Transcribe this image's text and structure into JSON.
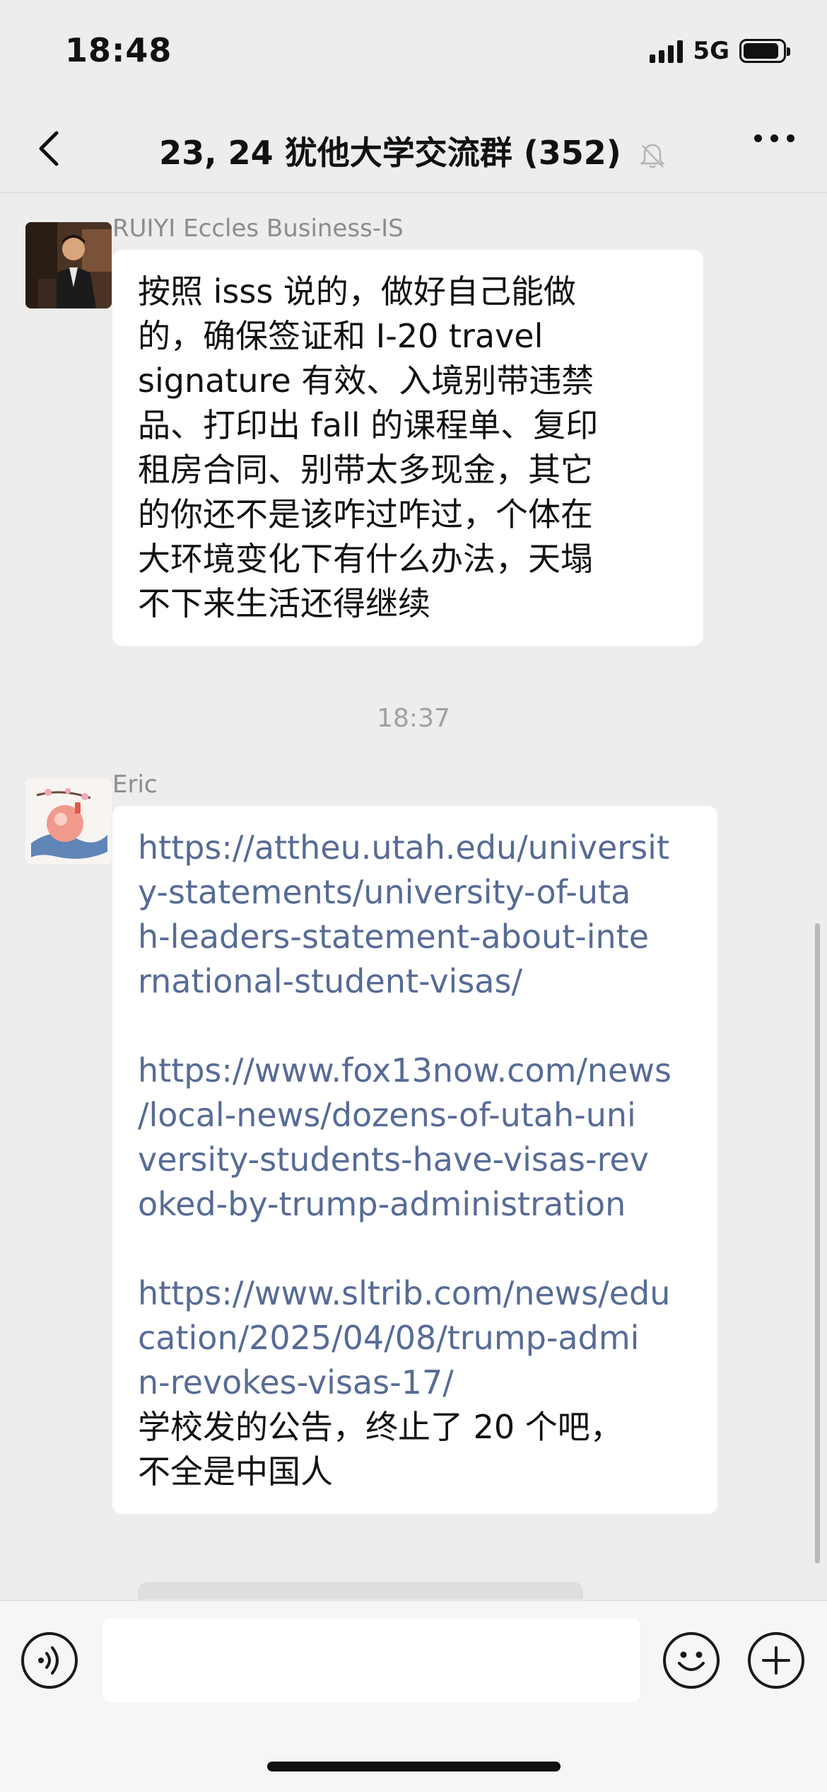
{
  "status_bar": {
    "time": "18:48",
    "network": "5G",
    "battery_level": 0.9
  },
  "nav": {
    "title": "23, 24 犹他大学交流群 (352)",
    "back_icon": "chevron-left-icon",
    "more_icon": "more-dots-icon",
    "mute_icon": "bell-muted-icon"
  },
  "messages": [
    {
      "sender": "RUIYI Eccles Business-IS",
      "lines": [
        "按照 isss 说的，做好自己能做",
        "的，确保签证和 I-20 travel",
        "signature 有效、入境别带违禁",
        "品、打印出 fall 的课程单、复印",
        "租房合同、别带太多现金，其它",
        "的你还不是该咋过咋过，个体在",
        "大环境变化下有什么办法，天塌",
        "不下来生活还得继续"
      ]
    },
    {
      "timestamp": "18:37",
      "sender": "Eric",
      "link_blocks": [
        [
          "https://attheu.utah.edu/universit",
          "y-statements/university-of-uta",
          "h-leaders-statement-about-inte",
          "rnational-student-visas/"
        ],
        [
          "https://www.fox13now.com/news",
          "/local-news/dozens-of-utah-uni",
          "versity-students-have-visas-rev",
          "oked-by-trump-administration"
        ],
        [
          "https://www.sltrib.com/news/edu",
          "cation/2025/04/08/trump-admi",
          "n-revokes-visas-17/"
        ]
      ],
      "text_lines": [
        "学校发的公告，终止了 20 个吧，",
        "不全是中国人"
      ]
    }
  ],
  "input_bar": {
    "voice_icon": "voice-input-icon",
    "emoji_icon": "emoji-icon",
    "plus_icon": "plus-icon",
    "placeholder": ""
  }
}
